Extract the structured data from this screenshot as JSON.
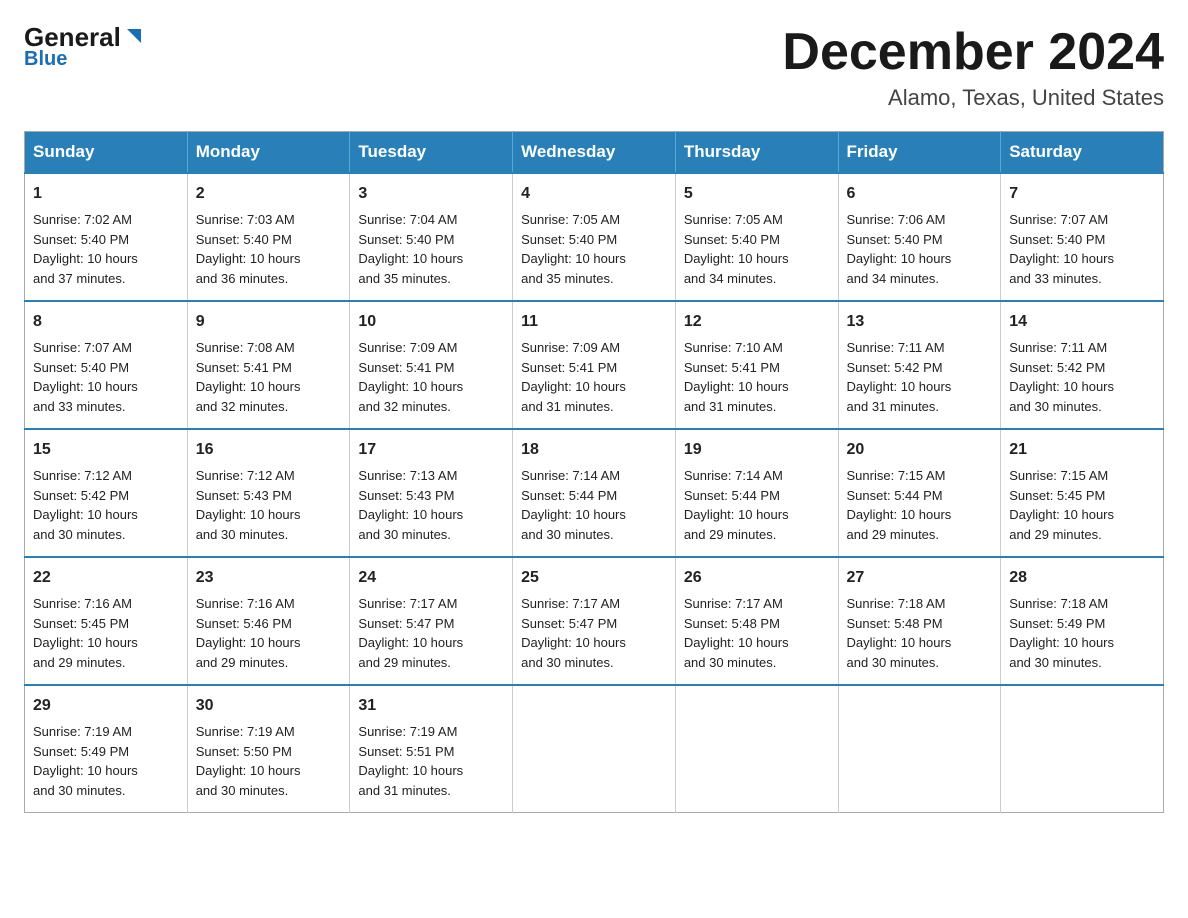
{
  "header": {
    "logo": {
      "general": "General",
      "blue": "Blue",
      "arrow": "▶"
    },
    "title": "December 2024",
    "location": "Alamo, Texas, United States"
  },
  "calendar": {
    "days_of_week": [
      "Sunday",
      "Monday",
      "Tuesday",
      "Wednesday",
      "Thursday",
      "Friday",
      "Saturday"
    ],
    "weeks": [
      [
        {
          "day": "1",
          "sunrise": "7:02 AM",
          "sunset": "5:40 PM",
          "daylight": "10 hours and 37 minutes."
        },
        {
          "day": "2",
          "sunrise": "7:03 AM",
          "sunset": "5:40 PM",
          "daylight": "10 hours and 36 minutes."
        },
        {
          "day": "3",
          "sunrise": "7:04 AM",
          "sunset": "5:40 PM",
          "daylight": "10 hours and 35 minutes."
        },
        {
          "day": "4",
          "sunrise": "7:05 AM",
          "sunset": "5:40 PM",
          "daylight": "10 hours and 35 minutes."
        },
        {
          "day": "5",
          "sunrise": "7:05 AM",
          "sunset": "5:40 PM",
          "daylight": "10 hours and 34 minutes."
        },
        {
          "day": "6",
          "sunrise": "7:06 AM",
          "sunset": "5:40 PM",
          "daylight": "10 hours and 34 minutes."
        },
        {
          "day": "7",
          "sunrise": "7:07 AM",
          "sunset": "5:40 PM",
          "daylight": "10 hours and 33 minutes."
        }
      ],
      [
        {
          "day": "8",
          "sunrise": "7:07 AM",
          "sunset": "5:40 PM",
          "daylight": "10 hours and 33 minutes."
        },
        {
          "day": "9",
          "sunrise": "7:08 AM",
          "sunset": "5:41 PM",
          "daylight": "10 hours and 32 minutes."
        },
        {
          "day": "10",
          "sunrise": "7:09 AM",
          "sunset": "5:41 PM",
          "daylight": "10 hours and 32 minutes."
        },
        {
          "day": "11",
          "sunrise": "7:09 AM",
          "sunset": "5:41 PM",
          "daylight": "10 hours and 31 minutes."
        },
        {
          "day": "12",
          "sunrise": "7:10 AM",
          "sunset": "5:41 PM",
          "daylight": "10 hours and 31 minutes."
        },
        {
          "day": "13",
          "sunrise": "7:11 AM",
          "sunset": "5:42 PM",
          "daylight": "10 hours and 31 minutes."
        },
        {
          "day": "14",
          "sunrise": "7:11 AM",
          "sunset": "5:42 PM",
          "daylight": "10 hours and 30 minutes."
        }
      ],
      [
        {
          "day": "15",
          "sunrise": "7:12 AM",
          "sunset": "5:42 PM",
          "daylight": "10 hours and 30 minutes."
        },
        {
          "day": "16",
          "sunrise": "7:12 AM",
          "sunset": "5:43 PM",
          "daylight": "10 hours and 30 minutes."
        },
        {
          "day": "17",
          "sunrise": "7:13 AM",
          "sunset": "5:43 PM",
          "daylight": "10 hours and 30 minutes."
        },
        {
          "day": "18",
          "sunrise": "7:14 AM",
          "sunset": "5:44 PM",
          "daylight": "10 hours and 30 minutes."
        },
        {
          "day": "19",
          "sunrise": "7:14 AM",
          "sunset": "5:44 PM",
          "daylight": "10 hours and 29 minutes."
        },
        {
          "day": "20",
          "sunrise": "7:15 AM",
          "sunset": "5:44 PM",
          "daylight": "10 hours and 29 minutes."
        },
        {
          "day": "21",
          "sunrise": "7:15 AM",
          "sunset": "5:45 PM",
          "daylight": "10 hours and 29 minutes."
        }
      ],
      [
        {
          "day": "22",
          "sunrise": "7:16 AM",
          "sunset": "5:45 PM",
          "daylight": "10 hours and 29 minutes."
        },
        {
          "day": "23",
          "sunrise": "7:16 AM",
          "sunset": "5:46 PM",
          "daylight": "10 hours and 29 minutes."
        },
        {
          "day": "24",
          "sunrise": "7:17 AM",
          "sunset": "5:47 PM",
          "daylight": "10 hours and 29 minutes."
        },
        {
          "day": "25",
          "sunrise": "7:17 AM",
          "sunset": "5:47 PM",
          "daylight": "10 hours and 30 minutes."
        },
        {
          "day": "26",
          "sunrise": "7:17 AM",
          "sunset": "5:48 PM",
          "daylight": "10 hours and 30 minutes."
        },
        {
          "day": "27",
          "sunrise": "7:18 AM",
          "sunset": "5:48 PM",
          "daylight": "10 hours and 30 minutes."
        },
        {
          "day": "28",
          "sunrise": "7:18 AM",
          "sunset": "5:49 PM",
          "daylight": "10 hours and 30 minutes."
        }
      ],
      [
        {
          "day": "29",
          "sunrise": "7:19 AM",
          "sunset": "5:49 PM",
          "daylight": "10 hours and 30 minutes."
        },
        {
          "day": "30",
          "sunrise": "7:19 AM",
          "sunset": "5:50 PM",
          "daylight": "10 hours and 30 minutes."
        },
        {
          "day": "31",
          "sunrise": "7:19 AM",
          "sunset": "5:51 PM",
          "daylight": "10 hours and 31 minutes."
        },
        null,
        null,
        null,
        null
      ]
    ],
    "labels": {
      "sunrise": "Sunrise:",
      "sunset": "Sunset:",
      "daylight": "Daylight:"
    }
  }
}
